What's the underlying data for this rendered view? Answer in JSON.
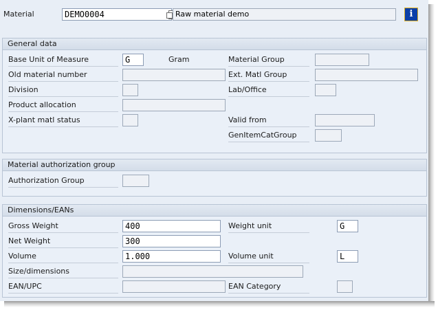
{
  "header": {
    "material_label": "Material",
    "material_value": "DEMO0004",
    "material_desc": "Raw material demo",
    "info_icon_glyph": "i"
  },
  "general": {
    "title": "General data",
    "base_uom_label": "Base Unit of Measure",
    "base_uom_value": "G",
    "base_uom_text": "Gram",
    "old_matnr_label": "Old material number",
    "division_label": "Division",
    "prod_alloc_label": "Product allocation",
    "xplant_status_label": "X-plant matl status",
    "matl_group_label": "Material Group",
    "ext_matl_group_label": "Ext. Matl Group",
    "lab_office_label": "Lab/Office",
    "valid_from_label": "Valid from",
    "gen_item_cat_label": "GenItemCatGroup"
  },
  "auth": {
    "title": "Material authorization group",
    "auth_group_label": "Authorization Group"
  },
  "dims": {
    "title": "Dimensions/EANs",
    "gross_weight_label": "Gross Weight",
    "gross_weight_value": "400",
    "net_weight_label": "Net Weight",
    "net_weight_value": "300",
    "volume_label": "Volume",
    "volume_value": "1.000",
    "size_label": "Size/dimensions",
    "ean_label": "EAN/UPC",
    "weight_unit_label": "Weight unit",
    "weight_unit_value": "G",
    "volume_unit_label": "Volume unit",
    "volume_unit_value": "L",
    "ean_category_label": "EAN Category"
  },
  "colors": {
    "screen_bg": "#e8eef6",
    "group_border": "#b8c4d4",
    "info_button": "#0b3fa8"
  }
}
